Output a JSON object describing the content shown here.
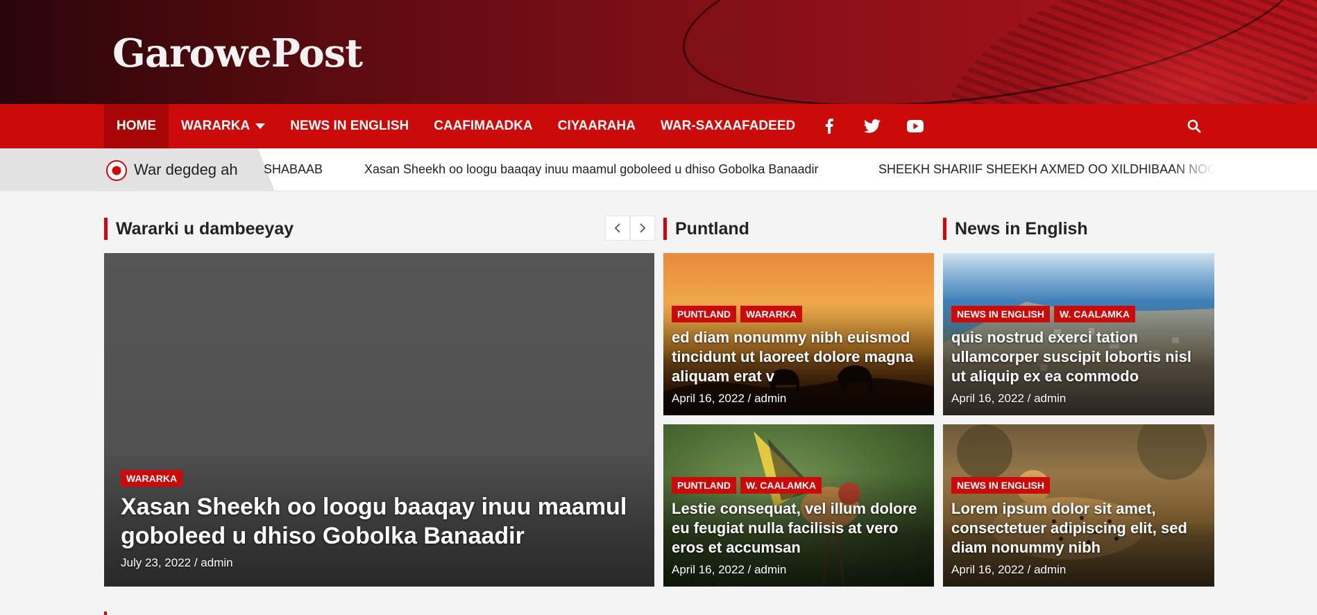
{
  "site": {
    "logo_text": "GarowePost"
  },
  "nav": {
    "items": [
      {
        "label": "HOME",
        "active": true
      },
      {
        "label": "WARARKA",
        "dropdown": true
      },
      {
        "label": "NEWS IN ENGLISH"
      },
      {
        "label": "CAAFIMAADKA"
      },
      {
        "label": "CIYAARAHA"
      },
      {
        "label": "WAR-SAXAAFADEED"
      }
    ],
    "social_icons": [
      "facebook-icon",
      "twitter-icon",
      "youtube-icon"
    ],
    "search_icon": "search-icon"
  },
  "ticker": {
    "label": "War degdeg ah",
    "items": [
      "SHABAAB",
      "Xasan Sheekh oo loogu baaqay inuu maamul goboleed u dhiso Gobolka Banaadir",
      "SHEEKH SHARIIF SHEEKH AXMED OO XILDHIBAAN NOQ"
    ]
  },
  "sections": {
    "latest": {
      "title": "Wararki u dambeeyay"
    },
    "puntland": {
      "title": "Puntland"
    },
    "english": {
      "title": "News in English"
    }
  },
  "featured": {
    "tags": [
      "WARARKA"
    ],
    "title": "Xasan Sheekh oo loogu baaqay inuu maamul goboleed u dhiso Gobolka Banaadir",
    "meta": "July 23, 2022 / admin"
  },
  "puntland_cards": [
    {
      "tags": [
        "PUNTLAND",
        "WARARKA"
      ],
      "title": "ed diam nonummy nibh euismod tincidunt ut laoreet dolore magna aliquam erat v",
      "meta": "April 16, 2022 / admin"
    },
    {
      "tags": [
        "PUNTLAND",
        "W. CAALAMKA"
      ],
      "title": "Lestie consequat, vel illum dolore eu feugiat nulla facilisis at vero eros et accumsan",
      "meta": "April 16, 2022 / admin"
    }
  ],
  "english_cards": [
    {
      "tags": [
        "NEWS IN ENGLISH",
        "W. CAALAMKA"
      ],
      "title": "quis nostrud exerci tation ullamcorper suscipit lobortis nisl ut aliquip ex ea commodo",
      "meta": "April 16, 2022 / admin"
    },
    {
      "tags": [
        "NEWS IN ENGLISH"
      ],
      "title": "Lorem ipsum dolor sit amet, consectetuer adipiscing elit, sed diam nonummy nibh",
      "meta": "April 16, 2022 / admin"
    }
  ],
  "colors": {
    "brand_red": "#cc0a0a",
    "nav_active": "#a80606"
  }
}
